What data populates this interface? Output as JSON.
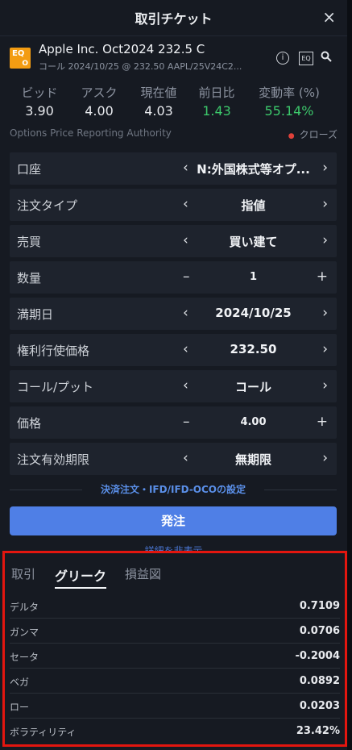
{
  "window": {
    "title": "取引チケット",
    "close": "×"
  },
  "instrument": {
    "logo_top": "EQ",
    "logo_bottom": "O",
    "name": "Apple Inc. Oct2024 232.5 C",
    "subtitle": "コール 2024/10/25 @ 232.50 AAPL/25V24C2...",
    "icons": [
      "info-icon",
      "eq-icon",
      "search-icon"
    ],
    "eq_label": "EQ"
  },
  "quote": {
    "bid_label": "ビッド",
    "bid": "3.90",
    "ask_label": "アスク",
    "ask": "4.00",
    "last_label": "現在値",
    "last": "4.03",
    "change_label": "前日比",
    "change": "1.43",
    "pct_label": "変動率 (%)",
    "pct": "55.14%"
  },
  "source": {
    "label": "Options Price Reporting Authority",
    "status": "クローズ"
  },
  "order": {
    "account": {
      "label": "口座",
      "value": "N:外国株式等オプ..."
    },
    "order_type": {
      "label": "注文タイプ",
      "value": "指値"
    },
    "side": {
      "label": "売買",
      "value": "買い建て"
    },
    "quantity": {
      "label": "数量",
      "value": "1"
    },
    "expiry": {
      "label": "満期日",
      "value": "2024/10/25"
    },
    "strike": {
      "label": "権利行使価格",
      "value": "232.50"
    },
    "call_put": {
      "label": "コール/プット",
      "value": "コール"
    },
    "price": {
      "label": "価格",
      "value": "4.00"
    },
    "validity": {
      "label": "注文有効期限",
      "value": "無期限"
    }
  },
  "settlement_link": "決済注文・IFD/IFD-OCOの設定",
  "submit_label": "発注",
  "hide_details": "詳細を非表示",
  "tabs": [
    "取引",
    "グリーク",
    "損益図"
  ],
  "active_tab": "グリーク",
  "greeks": [
    {
      "name": "デルタ",
      "value": "0.7109"
    },
    {
      "name": "ガンマ",
      "value": "0.0706"
    },
    {
      "name": "セータ",
      "value": "-0.2004"
    },
    {
      "name": "ベガ",
      "value": "0.0892"
    },
    {
      "name": "ロー",
      "value": "0.0203"
    },
    {
      "name": "ボラティリティ",
      "value": "23.42%"
    }
  ],
  "colors": {
    "accent": "#4f7fe6",
    "positive": "#3cc86b",
    "status_dot": "#e0413a",
    "highlight_border": "#e3160f"
  }
}
